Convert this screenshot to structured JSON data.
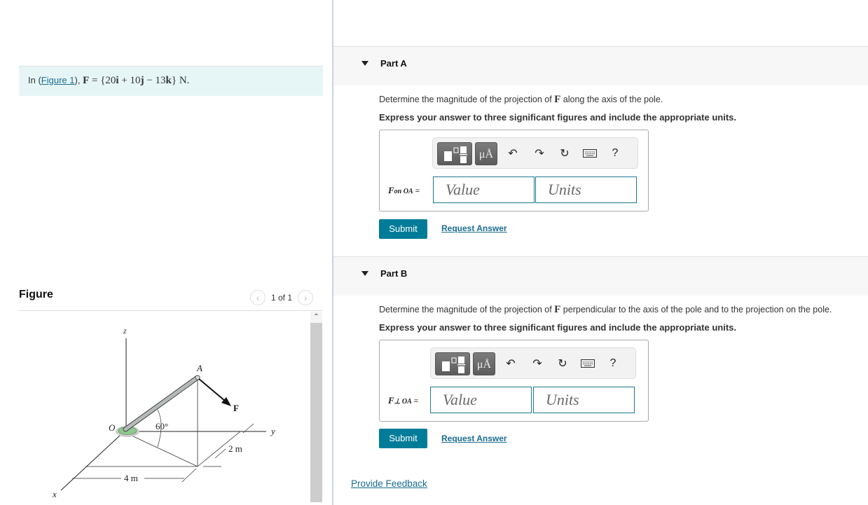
{
  "problem": {
    "intro_prefix": "In (",
    "figure_link": "Figure 1",
    "intro_suffix": "),",
    "force_expr_bold": "F",
    "force_expr_eq": " = {20",
    "force_i": "i",
    "force_mid1": " + 10",
    "force_j": "j",
    "force_mid2": " − 13",
    "force_k": "k",
    "force_end": "} N."
  },
  "figure_panel": {
    "title": "Figure",
    "pager_text": "1 of 1",
    "prev_icon": "chevron-left-icon",
    "next_icon": "chevron-right-icon"
  },
  "figure": {
    "labels": {
      "z": "z",
      "x": "x",
      "y": "y",
      "O": "O",
      "A": "A",
      "F": "F",
      "angle": "60°",
      "dim_y": "2 m",
      "dim_x": "4 m"
    },
    "colors": {
      "pole": "#a9b0b0",
      "base": "#8ec98e"
    }
  },
  "parts": [
    {
      "label": "Part A",
      "question_prefix": "Determine the magnitude of the projection of ",
      "question_bold": "F",
      "question_suffix": " along the axis of the pole.",
      "instruction": "Express your answer to three significant figures and include the appropriate units.",
      "eq_var": "F",
      "eq_sub": "on OA",
      "eq_sign": "=",
      "value_placeholder": "Value",
      "units_placeholder": "Units",
      "submit_label": "Submit",
      "request_label": "Request Answer"
    },
    {
      "label": "Part B",
      "question_prefix": "Determine the magnitude of the projection of ",
      "question_bold": "F",
      "question_suffix": " perpendicular to the axis of the pole and to the projection on the pole.",
      "instruction": "Express your answer to three significant figures and include the appropriate units.",
      "eq_var": "F",
      "eq_sub": "⊥ OA",
      "eq_sign": "=",
      "value_placeholder": "Value",
      "units_placeholder": "Units",
      "submit_label": "Submit",
      "request_label": "Request Answer"
    }
  ],
  "toolbar": {
    "units_button": "μÅ",
    "help": "?",
    "icons": [
      "templates-icon",
      "units-icon",
      "undo-icon",
      "redo-icon",
      "reset-icon",
      "keyboard-icon",
      "help-icon"
    ]
  },
  "footer": {
    "feedback_label": "Provide Feedback"
  },
  "colors": {
    "accent": "#007c98",
    "link": "#1a6c8f",
    "intro_bg": "#e6f6f7",
    "part_bg": "#f7f7f7"
  }
}
